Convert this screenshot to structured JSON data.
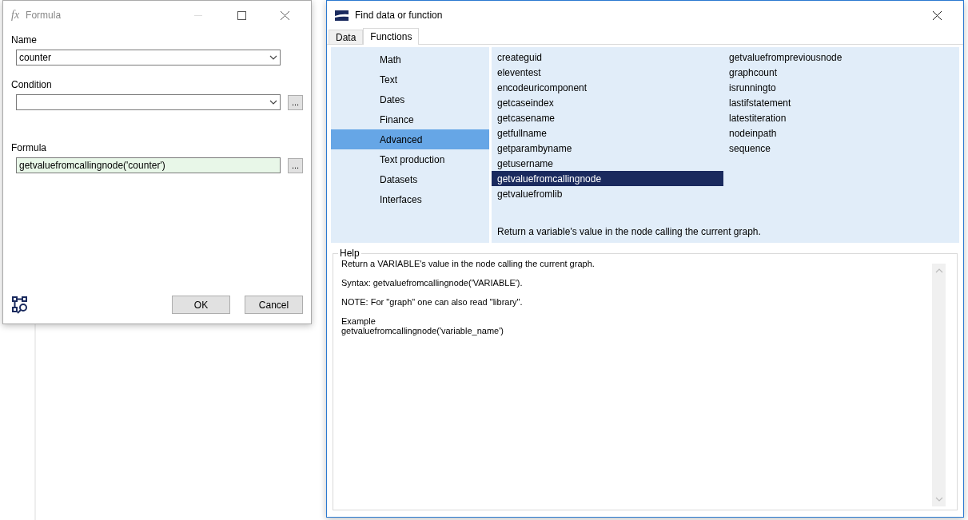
{
  "formula_window": {
    "icon_text": "fx",
    "title": "Formula",
    "fields": [
      {
        "kind": "combo",
        "label": "Name",
        "value": "counter"
      },
      {
        "kind": "combo",
        "label": "Condition",
        "browse": "..."
      },
      {
        "kind": "text",
        "label": "Formula",
        "value": "getvaluefromcallingnode('counter')",
        "browse": "..."
      }
    ],
    "buttons": [
      "OK",
      "Cancel"
    ]
  },
  "find_window": {
    "title": "Find data or function",
    "tabs": [
      {
        "label": "Data",
        "selected": false
      },
      {
        "label": "Functions",
        "selected": true
      }
    ],
    "categories": [
      {
        "label": "Math",
        "selected": false
      },
      {
        "label": "Text",
        "selected": false
      },
      {
        "label": "Dates",
        "selected": false
      },
      {
        "label": "Finance",
        "selected": false
      },
      {
        "label": "Advanced",
        "selected": true
      },
      {
        "label": "Text production",
        "selected": false
      },
      {
        "label": "Datasets",
        "selected": false
      },
      {
        "label": "Interfaces",
        "selected": false
      }
    ],
    "function_columns": [
      [
        {
          "label": "createguid",
          "selected": false
        },
        {
          "label": "eleventest",
          "selected": false
        },
        {
          "label": "encodeuricomponent",
          "selected": false
        },
        {
          "label": "getcaseindex",
          "selected": false
        },
        {
          "label": "getcasename",
          "selected": false
        },
        {
          "label": "getfullname",
          "selected": false
        },
        {
          "label": "getparambyname",
          "selected": false
        },
        {
          "label": "getusername",
          "selected": false
        },
        {
          "label": "getvaluefromcallingnode",
          "selected": true
        },
        {
          "label": "getvaluefromlib",
          "selected": false
        }
      ],
      [
        {
          "label": "getvaluefrompreviousnode",
          "selected": false
        },
        {
          "label": "graphcount",
          "selected": false
        },
        {
          "label": "isrunningto",
          "selected": false
        },
        {
          "label": "lastifstatement",
          "selected": false
        },
        {
          "label": "latestiteration",
          "selected": false
        },
        {
          "label": "nodeinpath",
          "selected": false
        },
        {
          "label": "sequence",
          "selected": false
        }
      ]
    ],
    "summary": "Return a variable's value in the node calling the current graph.",
    "help": {
      "title": "Help",
      "paragraphs": [
        [
          "Return a VARIABLE's value in the node calling the current graph."
        ],
        [
          "Syntax: getvaluefromcallingnode('VARIABLE')."
        ],
        [
          "NOTE: For \"graph\" one can also read \"library\"."
        ],
        [
          "Example",
          "getvaluefromcallingnode('variable_name')"
        ]
      ]
    }
  }
}
